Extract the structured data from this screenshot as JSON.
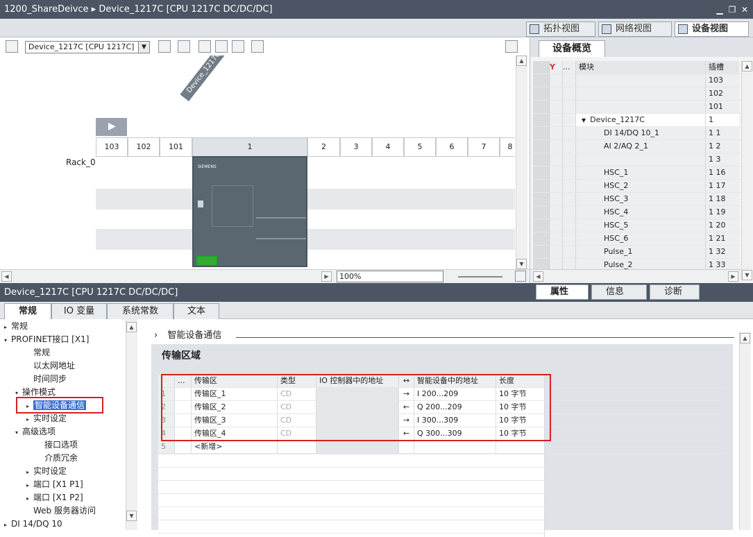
{
  "window": {
    "title": "1200_ShareDeivce ▸ Device_1217C [CPU 1217C DC/DC/DC]"
  },
  "view_tabs": [
    {
      "label": "拓扑视图"
    },
    {
      "label": "网络视图"
    },
    {
      "label": "设备视图"
    }
  ],
  "toolbar": {
    "device_select": "Device_1217C [CPU 1217C]"
  },
  "canvas": {
    "device_tag": "Device_1217C",
    "rack_label": "Rack_0",
    "slots": [
      "103",
      "102",
      "101",
      "1",
      "2",
      "3",
      "4",
      "5",
      "6",
      "7",
      "8"
    ],
    "cpu_brand": "SIEMENS",
    "cpu_model": "CPU 1217C DC/DC/DC",
    "zoom": "100%"
  },
  "overview": {
    "tab": "设备概览",
    "headers": {
      "dots": "...",
      "module": "模块",
      "slot": "插槽"
    },
    "rows": [
      {
        "module": "",
        "slot": "103"
      },
      {
        "module": "",
        "slot": "102"
      },
      {
        "module": "",
        "slot": "101"
      },
      {
        "module": "Device_1217C",
        "slot": "1"
      },
      {
        "module": "DI 14/DQ 10_1",
        "slot": "1 1"
      },
      {
        "module": "AI 2/AQ 2_1",
        "slot": "1 2"
      },
      {
        "module": "",
        "slot": "1 3"
      },
      {
        "module": "HSC_1",
        "slot": "1 16"
      },
      {
        "module": "HSC_2",
        "slot": "1 17"
      },
      {
        "module": "HSC_3",
        "slot": "1 18"
      },
      {
        "module": "HSC_4",
        "slot": "1 19"
      },
      {
        "module": "HSC_5",
        "slot": "1 20"
      },
      {
        "module": "HSC_6",
        "slot": "1 21"
      },
      {
        "module": "Pulse_1",
        "slot": "1 32"
      },
      {
        "module": "Pulse_2",
        "slot": "1 33"
      }
    ]
  },
  "inspector": {
    "title": "Device_1217C [CPU 1217C DC/DC/DC]",
    "right_tabs": [
      "属性",
      "信息",
      "诊断"
    ],
    "tabs": [
      "常规",
      "IO 变量",
      "系统常数",
      "文本"
    ]
  },
  "tree": [
    {
      "label": "常规",
      "indent": 0,
      "arrow": "▸"
    },
    {
      "label": "PROFINET接口 [X1]",
      "indent": 0,
      "arrow": "▾"
    },
    {
      "label": "常规",
      "indent": 2,
      "arrow": ""
    },
    {
      "label": "以太网地址",
      "indent": 2,
      "arrow": ""
    },
    {
      "label": "时间同步",
      "indent": 2,
      "arrow": ""
    },
    {
      "label": "操作模式",
      "indent": 1,
      "arrow": "▾"
    },
    {
      "label": "智能设备通信",
      "indent": 2,
      "arrow": "▸"
    },
    {
      "label": "实时设定",
      "indent": 2,
      "arrow": "▸"
    },
    {
      "label": "高级选项",
      "indent": 1,
      "arrow": "▾"
    },
    {
      "label": "接口选项",
      "indent": 3,
      "arrow": ""
    },
    {
      "label": "介质冗余",
      "indent": 3,
      "arrow": ""
    },
    {
      "label": "实时设定",
      "indent": 2,
      "arrow": "▸"
    },
    {
      "label": "端口 [X1 P1]",
      "indent": 2,
      "arrow": "▸"
    },
    {
      "label": "端口 [X1 P2]",
      "indent": 2,
      "arrow": "▸"
    },
    {
      "label": "Web 服务器访问",
      "indent": 2,
      "arrow": ""
    },
    {
      "label": "DI 14/DQ 10",
      "indent": 0,
      "arrow": "▸"
    }
  ],
  "content": {
    "breadcrumb": "智能设备通信",
    "section_title": "传输区域",
    "headers": {
      "dots": "...",
      "area": "传输区",
      "type": "类型",
      "ctrl_addr": "IO 控制器中的地址",
      "dir": "↔",
      "dev_addr": "智能设备中的地址",
      "len": "长度"
    },
    "rows": [
      {
        "n": "1",
        "area": "传输区_1",
        "type": "CD",
        "dir": "→",
        "dev_addr": "I 200...209",
        "len": "10 字节"
      },
      {
        "n": "2",
        "area": "传输区_2",
        "type": "CD",
        "dir": "←",
        "dev_addr": "Q 200...209",
        "len": "10 字节"
      },
      {
        "n": "3",
        "area": "传输区_3",
        "type": "CD",
        "dir": "→",
        "dev_addr": "I 300...309",
        "len": "10 字节"
      },
      {
        "n": "4",
        "area": "传输区_4",
        "type": "CD",
        "dir": "←",
        "dev_addr": "Q 300...309",
        "len": "10 字节"
      }
    ],
    "new_row": {
      "n": "5",
      "label": "<新增>"
    }
  }
}
